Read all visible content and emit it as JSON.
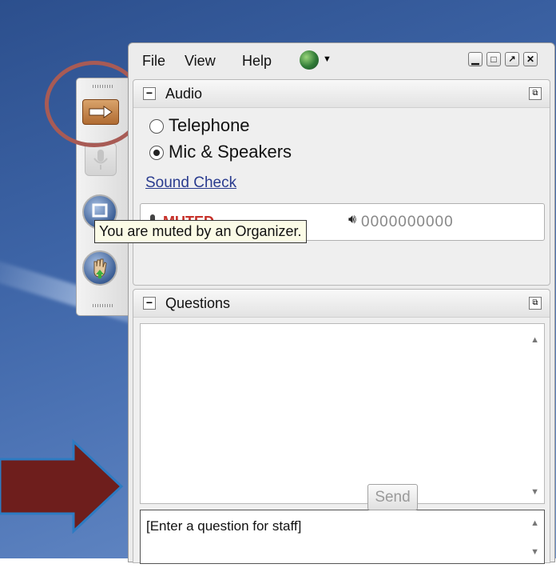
{
  "menu": {
    "file": "File",
    "view": "View",
    "help": "Help",
    "window_controls": [
      "minimize-icon",
      "maximize-icon",
      "popout-icon",
      "close-icon"
    ]
  },
  "audio": {
    "title": "Audio",
    "telephone_label": "Telephone",
    "mic_label": "Mic & Speakers",
    "selected": "Mic & Speakers",
    "sound_check_link": "Sound Check",
    "status": "MUTED",
    "level_text": "0000000000"
  },
  "tooltip": "You are muted by an Organizer.",
  "questions": {
    "title": "Questions",
    "input_placeholder": "[Enter a question for staff]",
    "send_label": "Send"
  },
  "colors": {
    "arrow": "#6e1e1c",
    "arrow_outline": "#2d7bc2",
    "circle": "#a85b55",
    "muted": "#c7312a"
  }
}
